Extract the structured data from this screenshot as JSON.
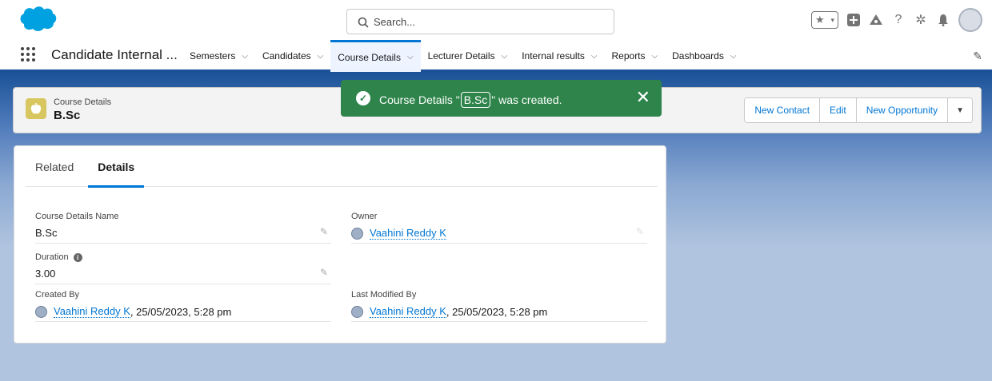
{
  "header": {
    "search_placeholder": "Search..."
  },
  "nav": {
    "app_name": "Candidate Internal ...",
    "items": [
      {
        "label": "Semesters"
      },
      {
        "label": "Candidates"
      },
      {
        "label": "Course Details",
        "active": true
      },
      {
        "label": "Lecturer Details"
      },
      {
        "label": "Internal results"
      },
      {
        "label": "Reports"
      },
      {
        "label": "Dashboards"
      }
    ]
  },
  "record": {
    "object_type": "Course Details",
    "name": "B.Sc",
    "actions": [
      "New Contact",
      "Edit",
      "New Opportunity"
    ]
  },
  "toast": {
    "prefix": "Course Details \"",
    "record": "B.Sc",
    "suffix": "\" was created.",
    "color": "#2e844a"
  },
  "tabs": [
    "Related",
    "Details"
  ],
  "fields": {
    "course_name": {
      "label": "Course Details Name",
      "value": "B.Sc"
    },
    "owner": {
      "label": "Owner",
      "value": "Vaahini Reddy K"
    },
    "duration": {
      "label": "Duration",
      "value": "3.00"
    },
    "created_by": {
      "label": "Created By",
      "user": "Vaahini Reddy K",
      "date": ", 25/05/2023, 5:28 pm"
    },
    "last_modified_by": {
      "label": "Last Modified By",
      "user": "Vaahini Reddy K",
      "date": ", 25/05/2023, 5:28 pm"
    }
  },
  "colors": {
    "brand_blue": "#0176d3",
    "nav_bar": "#1b5297",
    "object_icon": "#d8c760"
  }
}
